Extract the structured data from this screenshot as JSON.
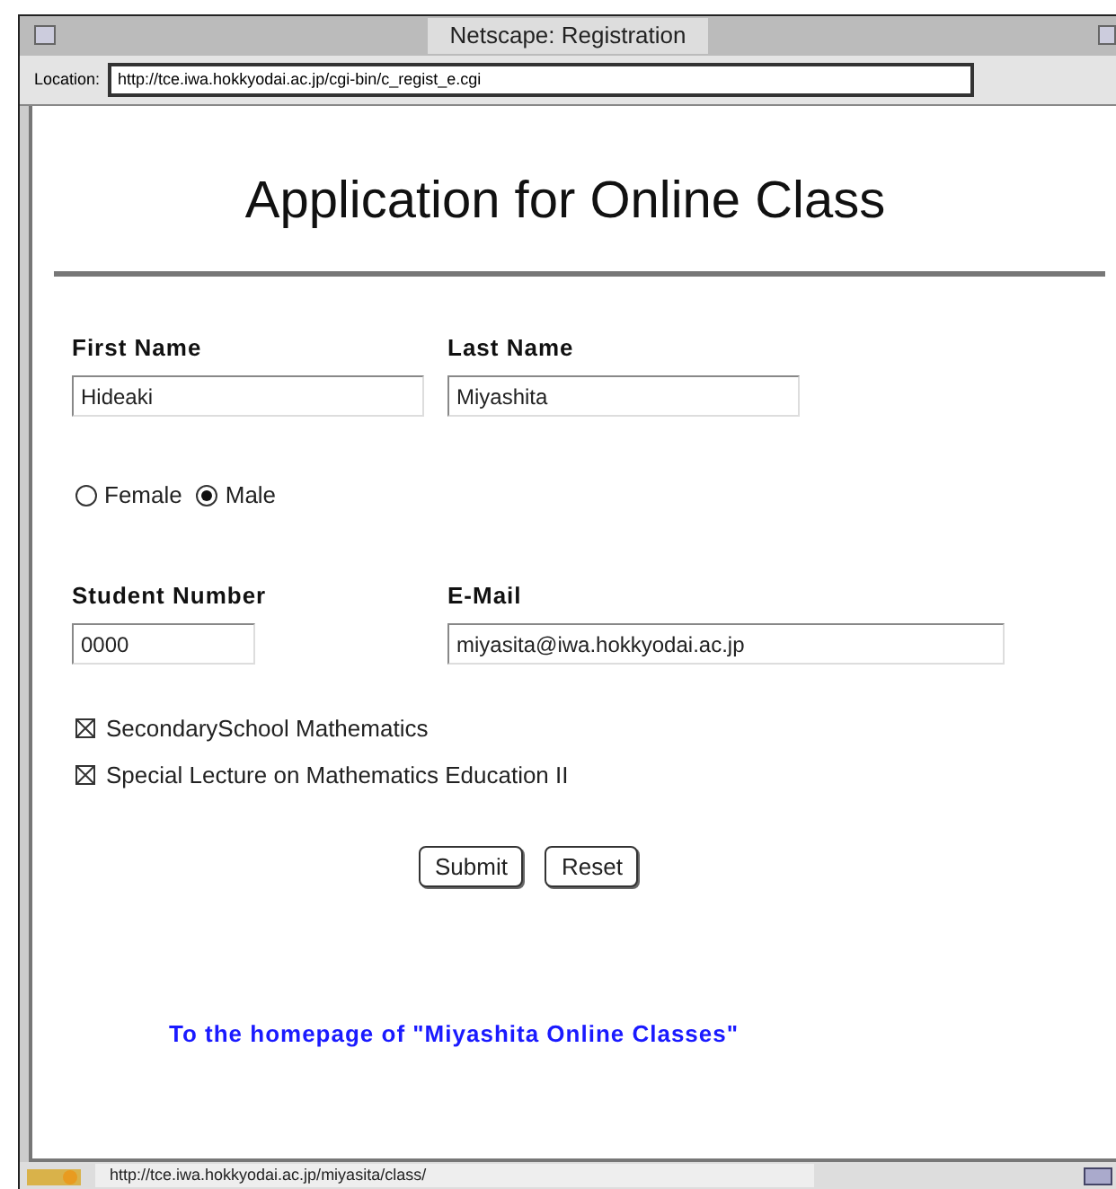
{
  "window": {
    "title": "Netscape: Registration"
  },
  "location": {
    "label": "Location:",
    "url": "http://tce.iwa.hokkyodai.ac.jp/cgi-bin/c_regist_e.cgi"
  },
  "page": {
    "heading": "Application for Online Class",
    "name_fields": [
      {
        "label": "First Name",
        "value": "Hideaki"
      },
      {
        "label": "Last Name",
        "value": "Miyashita"
      }
    ],
    "gender": [
      {
        "label": "Female",
        "selected": false
      },
      {
        "label": "Male",
        "selected": true
      }
    ],
    "id_fields": [
      {
        "label": "Student Number",
        "value": "0000"
      },
      {
        "label": "E-Mail",
        "value": "miyasita@iwa.hokkyodai.ac.jp"
      }
    ],
    "courses": [
      {
        "label": "SecondarySchool Mathematics",
        "checked": true
      },
      {
        "label": "Special Lecture on Mathematics Education II",
        "checked": true
      }
    ],
    "buttons": [
      "Submit",
      "Reset"
    ],
    "link": "To the homepage of \"Miyashita Online Classes\""
  },
  "status_bar": {
    "text": "http://tce.iwa.hokkyodai.ac.jp/miyasita/class/"
  }
}
